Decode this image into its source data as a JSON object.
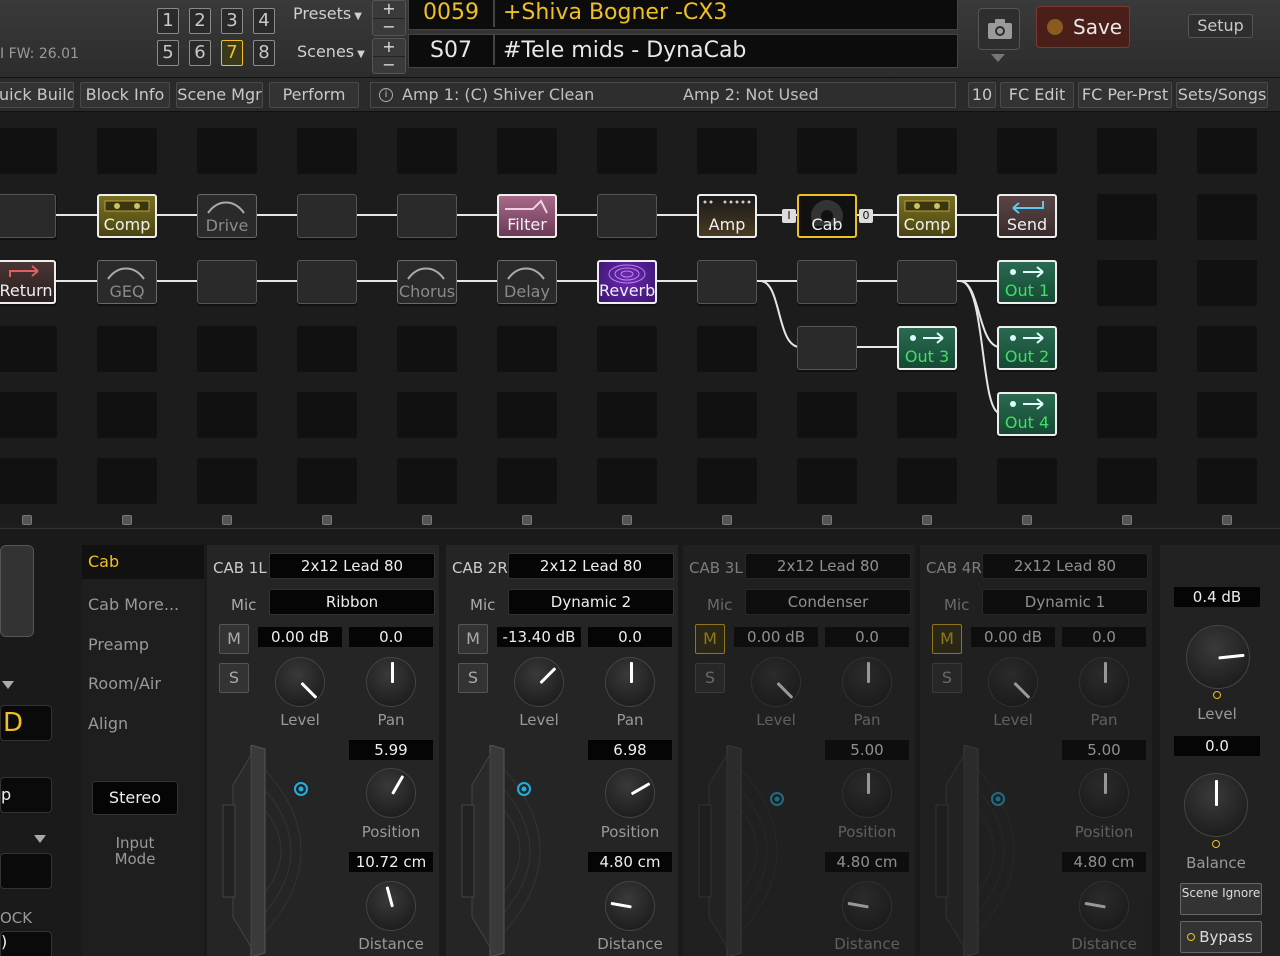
{
  "header": {
    "firmware": "I FW: 26.01",
    "scene_buttons": [
      {
        "label": "1",
        "active": false
      },
      {
        "label": "2",
        "active": false
      },
      {
        "label": "3",
        "active": false
      },
      {
        "label": "4",
        "active": false
      },
      {
        "label": "5",
        "active": false
      },
      {
        "label": "6",
        "active": false
      },
      {
        "label": "7",
        "active": true
      },
      {
        "label": "8",
        "active": false
      }
    ],
    "presets_label": "Presets",
    "scenes_label": "Scenes",
    "preset_number": "0059",
    "preset_name": "+Shiva Bogner -CX3",
    "scene_number": "S07",
    "scene_name": "#Tele mids - DynaCab",
    "plus": "+",
    "minus": "−",
    "save_label": "Save",
    "setup_label": "Setup"
  },
  "toolbar": {
    "quick_build": "uick Build",
    "block_info": "Block Info",
    "scene_mgr": "Scene Mgr",
    "perform": "Perform",
    "info_icon": "i",
    "amp1": "Amp 1: (C) Shiver Clean",
    "amp2": "Amp 2: Not Used",
    "count": "10",
    "fc_edit": "FC Edit",
    "fc_per_prst": "FC Per-Prst",
    "sets_songs": "Sets/Songs"
  },
  "grid": {
    "row1": {
      "comp": "Comp",
      "drive": "Drive",
      "filter": "Filter",
      "amp": "Amp",
      "cab": "Cab",
      "comp2": "Comp",
      "send": "Send",
      "in_tag": "I",
      "out_tag": "0"
    },
    "row2": {
      "return": "Return",
      "geq": "GEQ",
      "chorus": "Chorus",
      "delay": "Delay",
      "reverb": "Reverb",
      "out1": "Out 1"
    },
    "row3": {
      "out3": "Out 3",
      "out2": "Out 2"
    },
    "row4": {
      "out4": "Out 4"
    }
  },
  "left": {
    "value_d": "D",
    "value_p": "p",
    "ock": "OCK",
    "paren": ")"
  },
  "tabs": {
    "cab": "Cab",
    "cab_more": "Cab More...",
    "preamp": "Preamp",
    "room_air": "Room/Air",
    "align": "Align",
    "stereo": "Stereo",
    "input_mode": "Input Mode"
  },
  "cabs": [
    {
      "title": "CAB 1L",
      "model": "2x12 Lead 80",
      "mic_label": "Mic",
      "mic": "Ribbon",
      "m": "M",
      "s": "S",
      "m_on": false,
      "level": "0.00 dB",
      "pan": "0.0",
      "level_label": "Level",
      "pan_label": "Pan",
      "position": "5.99",
      "position_label": "Position",
      "distance": "10.72 cm",
      "distance_label": "Distance"
    },
    {
      "title": "CAB 2R",
      "model": "2x12 Lead 80",
      "mic_label": "Mic",
      "mic": "Dynamic 2",
      "m": "M",
      "s": "S",
      "m_on": false,
      "level": "-13.40 dB",
      "pan": "0.0",
      "level_label": "Level",
      "pan_label": "Pan",
      "position": "6.98",
      "position_label": "Position",
      "distance": "4.80 cm",
      "distance_label": "Distance"
    },
    {
      "title": "CAB 3L",
      "model": "2x12 Lead 80",
      "mic_label": "Mic",
      "mic": "Condenser",
      "m": "M",
      "s": "S",
      "m_on": true,
      "level": "0.00 dB",
      "pan": "0.0",
      "level_label": "Level",
      "pan_label": "Pan",
      "position": "5.00",
      "position_label": "Position",
      "distance": "4.80 cm",
      "distance_label": "Distance"
    },
    {
      "title": "CAB 4R",
      "model": "2x12 Lead 80",
      "mic_label": "Mic",
      "mic": "Dynamic 1",
      "m": "M",
      "s": "S",
      "m_on": true,
      "level": "0.00 dB",
      "pan": "0.0",
      "level_label": "Level",
      "pan_label": "Pan",
      "position": "5.00",
      "position_label": "Position",
      "distance": "4.80 cm",
      "distance_label": "Distance"
    }
  ],
  "master": {
    "level": "0.4 dB",
    "level_label": "Level",
    "balance": "0.0",
    "balance_label": "Balance",
    "scene_ignore": "Scene Ignore",
    "bypass": "Bypass"
  }
}
